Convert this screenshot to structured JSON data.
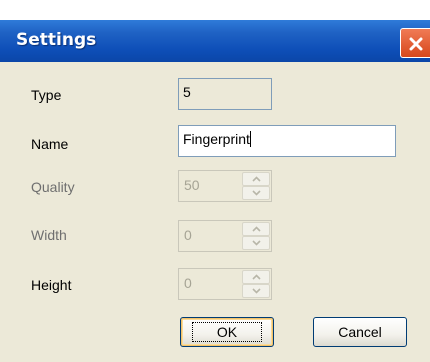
{
  "window": {
    "title": "Settings"
  },
  "fields": {
    "type": {
      "label": "Type",
      "value": "5"
    },
    "name": {
      "label": "Name",
      "value": "Fingerprint"
    },
    "quality": {
      "label": "Quality",
      "value": "50"
    },
    "width": {
      "label": "Width",
      "value": "0"
    },
    "height": {
      "label": "Height",
      "value": "0"
    }
  },
  "buttons": {
    "ok": "OK",
    "cancel": "Cancel"
  },
  "colors": {
    "titlebar": "#0e4fb8",
    "close": "#d7471c",
    "dialog_bg": "#ece9d8"
  },
  "icons": {
    "close": "close-icon",
    "spin_up": "chevron-up-icon",
    "spin_down": "chevron-down-icon"
  }
}
